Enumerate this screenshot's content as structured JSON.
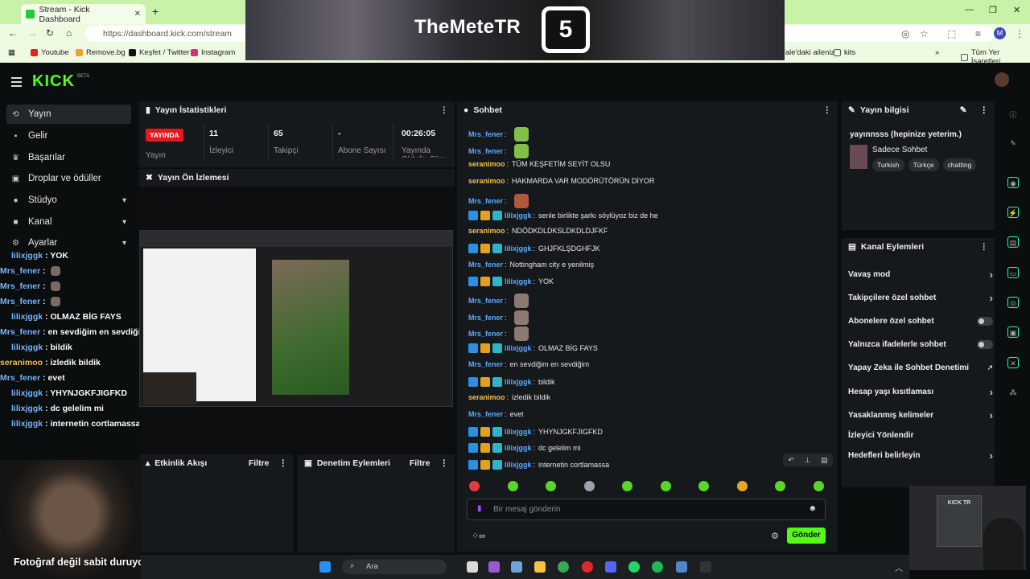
{
  "browser": {
    "tab_title": "Stream - Kick Dashboard",
    "url": "https://dashboard.kick.com/stream",
    "profile_initial": "M",
    "bookmarks": [
      "Youtube",
      "Remove.bg",
      "Keşfet / Twitter",
      "Instagram"
    ],
    "bookmarks_right": [
      "'ale'daki aileniz",
      "kits",
      "Tüm Yer İşaretleri"
    ]
  },
  "overlay": {
    "banner_title": "TheMeteTR",
    "banner_logo": "5",
    "caption": "Fotoğraf değil sabit duruyorum",
    "cam2_label": "KICK TR"
  },
  "kick": {
    "logo": "KICK",
    "beta": "BETA"
  },
  "sidebar": {
    "items": [
      {
        "label": "Yayın",
        "icon": "⟲"
      },
      {
        "label": "Gelir",
        "icon": "▪"
      },
      {
        "label": "Başarılar",
        "icon": "♛"
      },
      {
        "label": "Droplar ve ödüller",
        "icon": "▣"
      },
      {
        "label": "Stüdyo",
        "icon": "●"
      },
      {
        "label": "Kanal",
        "icon": "■"
      },
      {
        "label": "Ayarlar",
        "icon": "⚙"
      }
    ]
  },
  "overlay_chat": [
    {
      "user": "lilixjggk",
      "text": "YOK",
      "orange": false
    },
    {
      "user": "Mrs_fener",
      "text": "",
      "orange": false
    },
    {
      "user": "Mrs_fener",
      "text": "",
      "orange": false
    },
    {
      "user": "Mrs_fener",
      "text": "",
      "orange": false
    },
    {
      "user": "lilixjggk",
      "text": "OLMAZ BİG FAYS",
      "orange": false
    },
    {
      "user": "Mrs_fener",
      "text": "en sevdiğim en sevdiğim",
      "orange": false
    },
    {
      "user": "lilixjggk",
      "text": "bildik",
      "orange": false
    },
    {
      "user": "seranimoo",
      "text": "izledik bildik",
      "orange": true
    },
    {
      "user": "Mrs_fener",
      "text": "evet",
      "orange": false
    },
    {
      "user": "lilixjggk",
      "text": "YHYNJGKFJIGFKD",
      "orange": false
    },
    {
      "user": "lilixjggk",
      "text": "dc gelelim mi",
      "orange": false
    },
    {
      "user": "lilixjggk",
      "text": "internetin cortlamassa",
      "orange": false
    }
  ],
  "stats": {
    "title": "Yayın İstatistikleri",
    "live_label": "YAYINDA",
    "live_caption": "Yayın",
    "viewers": "11",
    "viewers_label": "İzleyici",
    "followers": "65",
    "followers_label": "Takipçi",
    "subs": "-",
    "subs_label": "Abone Sayısı",
    "uptime": "00:26:05",
    "uptime_label": "Yayında Olduğu Süre"
  },
  "preview": {
    "title": "Yayın Ön İzlemesi"
  },
  "activity": {
    "title": "Etkinlik Akışı",
    "filter": "Filtre"
  },
  "moderation": {
    "title": "Denetim Eylemleri",
    "filter": "Filtre"
  },
  "chat": {
    "title": "Sohbet",
    "messages": [
      {
        "user": "Mrs_fener",
        "text": "",
        "badges": false,
        "emote": "#7fbf4a",
        "orange": false
      },
      {
        "user": "Mrs_fener",
        "text": "",
        "badges": false,
        "emote": "#7fbf4a",
        "orange": false
      },
      {
        "user": "seranimoo",
        "text": "TÜM KEŞFETİM SEYİT OLSU",
        "badges": false,
        "emote": "",
        "orange": true
      },
      {
        "user": "seranimoo",
        "text": "HAKMARDA VAR MODÖRÜTÖRÜN DİYOR",
        "badges": false,
        "emote": "",
        "orange": true
      },
      {
        "user": "Mrs_fener",
        "text": "",
        "badges": false,
        "emote": "#b5573a",
        "orange": false
      },
      {
        "user": "lilixjggk",
        "text": "senle birlikte şarkı söylüyoz biz de he",
        "badges": true,
        "emote": "",
        "orange": false
      },
      {
        "user": "seranimoo",
        "text": "NDÖDKDLDKSLDKDLDJFKF",
        "badges": false,
        "emote": "",
        "orange": true
      },
      {
        "user": "lilixjggk",
        "text": "GHJFKLŞDGHFJK",
        "badges": true,
        "emote": "",
        "orange": false
      },
      {
        "user": "Mrs_fener",
        "text": "Nottingham city e yenilmiş",
        "badges": false,
        "emote": "",
        "orange": false
      },
      {
        "user": "lilixjggk",
        "text": "YOK",
        "badges": true,
        "emote": "",
        "orange": false
      },
      {
        "user": "Mrs_fener",
        "text": "",
        "badges": false,
        "emote": "#8a7a72",
        "orange": false
      },
      {
        "user": "Mrs_fener",
        "text": "",
        "badges": false,
        "emote": "#8a7a72",
        "orange": false
      },
      {
        "user": "Mrs_fener",
        "text": "",
        "badges": false,
        "emote": "#8a7a72",
        "orange": false
      },
      {
        "user": "lilixjggk",
        "text": "OLMAZ BİG FAYS",
        "badges": true,
        "emote": "",
        "orange": false
      },
      {
        "user": "Mrs_fener",
        "text": "en sevdiğim en sevdiğim",
        "badges": false,
        "emote": "",
        "orange": false
      },
      {
        "user": "lilixjggk",
        "text": "bildik",
        "badges": true,
        "emote": "",
        "orange": false
      },
      {
        "user": "seranimoo",
        "text": "izledik bildik",
        "badges": false,
        "emote": "",
        "orange": true
      },
      {
        "user": "Mrs_fener",
        "text": "evet",
        "badges": false,
        "emote": "",
        "orange": false
      },
      {
        "user": "lilixjggk",
        "text": "YHYNJGKFJIGFKD",
        "badges": true,
        "emote": "",
        "orange": false
      },
      {
        "user": "lilixjggk",
        "text": "dc gelelim mi",
        "badges": true,
        "emote": "",
        "orange": false
      },
      {
        "user": "lilixjggk",
        "text": "internetin cortlamassa",
        "badges": true,
        "emote": "",
        "orange": false
      }
    ],
    "input_placeholder": "Bir mesaj gönderin",
    "send_label": "Gönder",
    "emote_colors": [
      "#e23b3b",
      "#58d62a",
      "#58d62a",
      "#9aa3ab",
      "#58d62a",
      "#58d62a",
      "#58d62a",
      "#e5a52a",
      "#58d62a",
      "#58d62a"
    ]
  },
  "stream_info": {
    "title": "Yayın bilgisi",
    "stream_title": "yayınnsss (hepinize yeterim.)",
    "category": "Sadece Sohbet",
    "tags": [
      "Turkish",
      "Türkçe",
      "chatting"
    ]
  },
  "channel_actions": {
    "title": "Kanal Eylemleri",
    "items": [
      {
        "label": "Vavaş mod",
        "control": "arrow"
      },
      {
        "label": "Takipçilere özel sohbet",
        "control": "arrow"
      },
      {
        "label": "Abonelere özel sohbet",
        "control": "toggle"
      },
      {
        "label": "Yalnızca ifadelerle sohbet",
        "control": "toggle"
      },
      {
        "label": "Yapay Zeka ile Sohbet Denetimi",
        "control": "external"
      },
      {
        "label": "Hesap yaşı kısıtlaması",
        "control": "arrow"
      },
      {
        "label": "Yasaklanmış kelimeler",
        "control": "arrow"
      },
      {
        "label": "İzleyici Yönlendir",
        "control": "none"
      },
      {
        "label": "Hedefleri belirleyin",
        "control": "arrow"
      }
    ]
  },
  "taskbar": {
    "search_label": "Ara"
  }
}
